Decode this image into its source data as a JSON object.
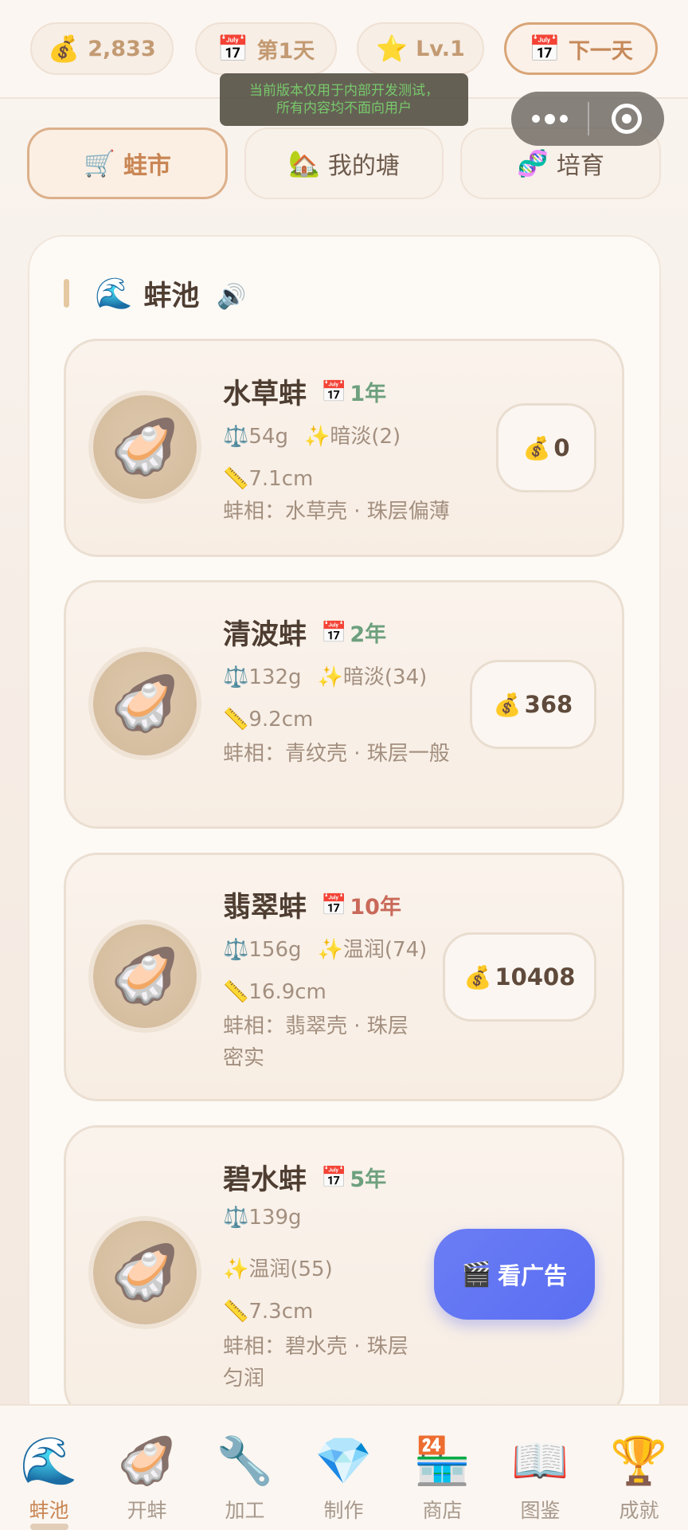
{
  "topbar": {
    "coins": "2,833",
    "coins_icon": "money-bag-icon",
    "day": "第1天",
    "day_icon": "calendar-icon",
    "level": "Lv.1",
    "level_icon": "star-icon",
    "next_day": "下一天"
  },
  "toast": {
    "line1": "当前版本仅用于内部开发测试，",
    "line2": "所有内容均不面向用户"
  },
  "tabs": [
    {
      "label": "蛙市",
      "icon": "cart-icon",
      "active": true
    },
    {
      "label": "我的塘",
      "icon": "house-icon",
      "active": false
    },
    {
      "label": "培育",
      "icon": "dna-icon",
      "active": false
    }
  ],
  "section": {
    "title": "蚌池",
    "icon": "wave-icon",
    "sound_icon": "speaker-icon"
  },
  "clams": [
    {
      "name": "水草蚌",
      "age": "1年",
      "age_color": "#6ea07e",
      "weight": "54g",
      "luster": "暗淡(2)",
      "size": "7.1cm",
      "appearance": "蚌相：水草壳 · 珠层偏薄",
      "price": "0"
    },
    {
      "name": "清波蚌",
      "age": "2年",
      "age_color": "#6ea07e",
      "weight": "132g",
      "luster": "暗淡(34)",
      "size": "9.2cm",
      "appearance": "蚌相：青纹壳 · 珠层一般",
      "price": "368"
    },
    {
      "name": "翡翠蚌",
      "age": "10年",
      "age_color": "#c9695a",
      "weight": "156g",
      "luster": "温润(74)",
      "size": "16.9cm",
      "appearance": "蚌相：翡翠壳 · 珠层密实",
      "price": "10408"
    },
    {
      "name": "碧水蚌",
      "age": "5年",
      "age_color": "#6ea07e",
      "weight": "139g",
      "luster": "温润(55)",
      "size": "7.3cm",
      "appearance": "蚌相：碧水壳 · 珠层匀润"
    }
  ],
  "ad_button": {
    "label": "看广告",
    "icon": "clapper-icon"
  },
  "bottom_nav": [
    {
      "label": "蚌池",
      "icon": "wave-icon",
      "active": true
    },
    {
      "label": "开蚌",
      "icon": "oyster-icon",
      "active": false
    },
    {
      "label": "加工",
      "icon": "wrench-icon",
      "active": false
    },
    {
      "label": "制作",
      "icon": "gem-icon",
      "active": false
    },
    {
      "label": "商店",
      "icon": "store-icon",
      "active": false
    },
    {
      "label": "图鉴",
      "icon": "book-icon",
      "active": false
    },
    {
      "label": "成就",
      "icon": "trophy-icon",
      "active": false
    }
  ],
  "colors": {
    "accent": "#c98654",
    "age_green": "#6ea07e",
    "age_red": "#c9695a",
    "ad_blue": "#5a6ef2"
  }
}
